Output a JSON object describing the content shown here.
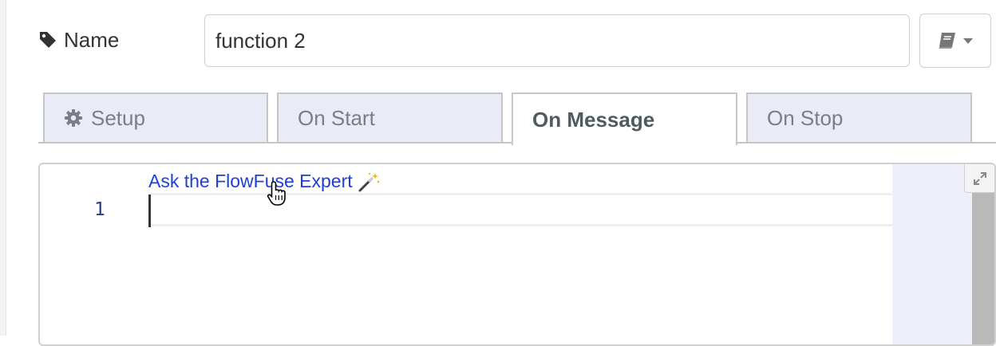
{
  "name_field": {
    "label": "Name",
    "value": "function 2"
  },
  "library_button": {
    "icon": "book-icon",
    "caret": "caret-down-icon"
  },
  "tabs": [
    {
      "label": "Setup",
      "icon": "gear-icon",
      "active": false
    },
    {
      "label": "On Start",
      "active": false
    },
    {
      "label": "On Message",
      "active": true
    },
    {
      "label": "On Stop",
      "active": false
    }
  ],
  "editor": {
    "ai_link": "Ask the FlowFuse Expert",
    "ai_icon": "magic-wand-icon",
    "line_numbers": [
      "1"
    ],
    "expand_icon": "expand-icon"
  },
  "colors": {
    "link": "#1f3fd6",
    "tab_inactive_bg": "#e9ebf7",
    "minimap": "#eeeffb"
  }
}
